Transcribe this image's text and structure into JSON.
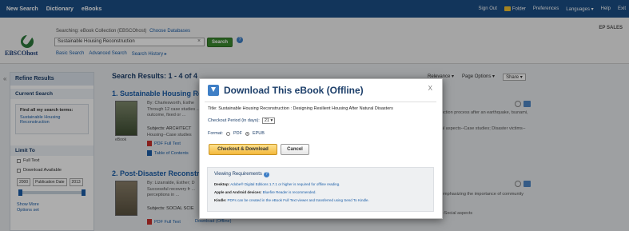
{
  "topnav": {
    "left": [
      "New Search",
      "Dictionary",
      "eBooks"
    ],
    "right": [
      "Sign Out",
      "Folder",
      "Preferences",
      "Languages ▾",
      "Help",
      "Exit"
    ]
  },
  "header": {
    "logo_text": "EBSCOhost",
    "searching_label": "Searching: eBook Collection (EBSCOhost)",
    "choose_db": "Choose Databases",
    "search_value": "Sustainable Housing Reconstruction",
    "search_button": "Search",
    "links": [
      "Basic Search",
      "Advanced Search",
      "Search History ▸"
    ],
    "account": "EP SALES"
  },
  "sidebar": {
    "title": "Refine Results",
    "current_search": "Current Search",
    "find_all": "Find all my search terms:",
    "find_all_value": "Sustainable Housing Reconstruction",
    "limit_to": "Limit To",
    "checks": [
      "Full Text",
      "Download Available"
    ],
    "date_from": "2000",
    "date_label": "Publication Date",
    "date_to": "2013",
    "show_more": "Show More",
    "options": "Options set"
  },
  "results": {
    "title": "Search Results: 1 - 4 of 4",
    "toolbar": [
      "Relevance ▾",
      "Page Options ▾",
      "Share ▾"
    ],
    "items": [
      {
        "title": "1. Sustainable Housing Re",
        "by": "By: Charlesworth, Esthe",
        "text": "Through 12 case studies ... outcome, fixed or ...",
        "snippet_right": "oction process after an earthquake, tsunami,",
        "snippet_right2": "al aspects--Case studies; Disaster victims--",
        "subjects": "Subjects: ARCHITECT",
        "subjects2": "Housing--Case studies",
        "cover_label": "eBook",
        "pdf": "PDF Full Text",
        "toc": "Table of Contents"
      },
      {
        "title": "2. Post-Disaster Reconstru",
        "by": "By: Lizarralde, Esther; D",
        "text": "Successful recovery fr ... perceptions in ...",
        "snippet_right": "emphasizing the importance of community",
        "snippet_right2": "--Social aspects",
        "subjects": "Subjects: SOCIAL SCIE",
        "subjects2": "",
        "cover_label": "",
        "pdf": "PDF Full Text",
        "toc": "Download (Offline)"
      }
    ]
  },
  "modal": {
    "title": "Download This eBook (Offline)",
    "close": "X",
    "book_title_label": "Title:",
    "book_title": "Sustainable Housing Reconstruction : Designing Resilient Housing After Natural Disasters",
    "checkout_label": "Checkout Period (in days):",
    "checkout_value": "21 ▾",
    "format_label": "Format:",
    "format_pdf": "PDF",
    "format_epub": "EPUB",
    "primary_button": "Checkout & Download",
    "cancel_button": "Cancel",
    "req_title": "Viewing Requirements",
    "req_lines": [
      {
        "label": "Desktop:",
        "text": "Adobe® Digital Editions 1.7.1 or higher is required for offline reading."
      },
      {
        "label": "Apple and Android devices:",
        "text": "Bluefire Reader is recommended."
      },
      {
        "label": "Kindle:",
        "text": "PDFs can be created in the eBook Full Text viewer and transferred using Send To Kindle."
      }
    ]
  },
  "colors": {
    "topnav": "#1b4f86",
    "accent": "#3f7fc6",
    "title": "#1d3f6a",
    "primary_btn": "#f3b83c"
  }
}
